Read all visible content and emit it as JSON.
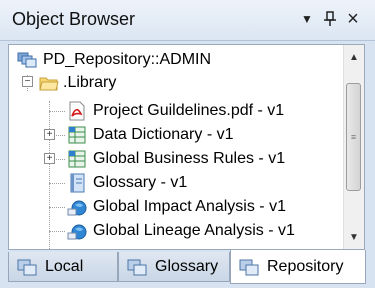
{
  "window": {
    "title": "Object Browser",
    "buttons": {
      "menu_glyph": "▼",
      "pin_glyph": "ᵖ",
      "close_glyph": "×"
    }
  },
  "tree": {
    "root": {
      "label": "PD_Repository::ADMIN",
      "icon": "repository-icon"
    },
    "folder": {
      "label": ".Library",
      "icon": "folder-open-icon",
      "expander": "−"
    },
    "items": [
      {
        "label": "Project Guildelines.pdf - v1",
        "icon": "pdf-icon",
        "expandable": false
      },
      {
        "label": "Data Dictionary - v1",
        "icon": "data-dictionary-icon",
        "expandable": true,
        "expander": "+"
      },
      {
        "label": "Global Business Rules - v1",
        "icon": "business-rules-icon",
        "expandable": true,
        "expander": "+"
      },
      {
        "label": "Glossary - v1",
        "icon": "glossary-icon",
        "expandable": false
      },
      {
        "label": "Global Impact Analysis - v1",
        "icon": "impact-analysis-icon",
        "expandable": false
      },
      {
        "label": "Global Lineage Analysis - v1",
        "icon": "lineage-analysis-icon",
        "expandable": false
      }
    ]
  },
  "scrollbar": {
    "up_glyph": "▲",
    "down_glyph": "▼",
    "grip_glyph": "≡"
  },
  "tabs": [
    {
      "label": "Local",
      "icon": "local-icon",
      "active": false
    },
    {
      "label": "Glossary",
      "icon": "glossary-tab-icon",
      "active": false
    },
    {
      "label": "Repository",
      "icon": "repository-tab-icon",
      "active": true
    }
  ]
}
